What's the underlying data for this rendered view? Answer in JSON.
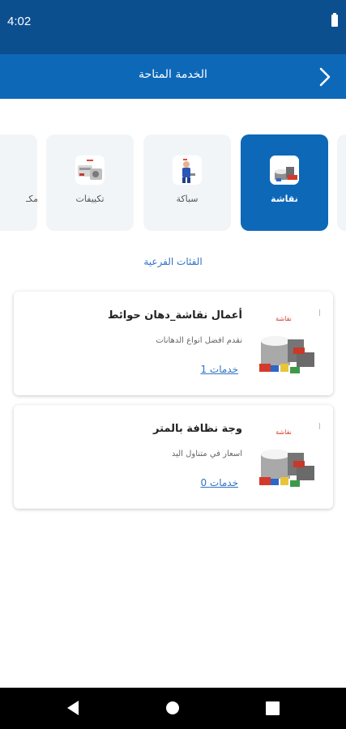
{
  "status_bar": {
    "time": "4:02"
  },
  "app_bar": {
    "title": "الخدمة المتاحة"
  },
  "categories": [
    {
      "label": "نقاشة",
      "active": true
    },
    {
      "label": "سباكة",
      "active": false
    },
    {
      "label": "تكييفات",
      "active": false
    },
    {
      "label": "مكـ",
      "active": false
    }
  ],
  "subcategories_title": "الفئات الفرعية",
  "subcategories": [
    {
      "title": "أعمال نقاشة_دهان حوائط",
      "description": "نقدم افضل انواع الدهانات",
      "services_link": "1 خدمات",
      "thumb_label": "نقاشة"
    },
    {
      "title": "وجة نظافة بالمتر",
      "description": "اسعار في متناول اليد",
      "services_link": "0 خدمات",
      "thumb_label": "نقاشة"
    }
  ],
  "nav_bar": {
    "back": "back-icon",
    "home": "home-icon",
    "recents": "recents-icon"
  },
  "colors": {
    "status_bar": "#0c4f8f",
    "app_bar": "#0d68b8",
    "accent": "#2f72c4",
    "card_bg": "#f2f5f8"
  }
}
